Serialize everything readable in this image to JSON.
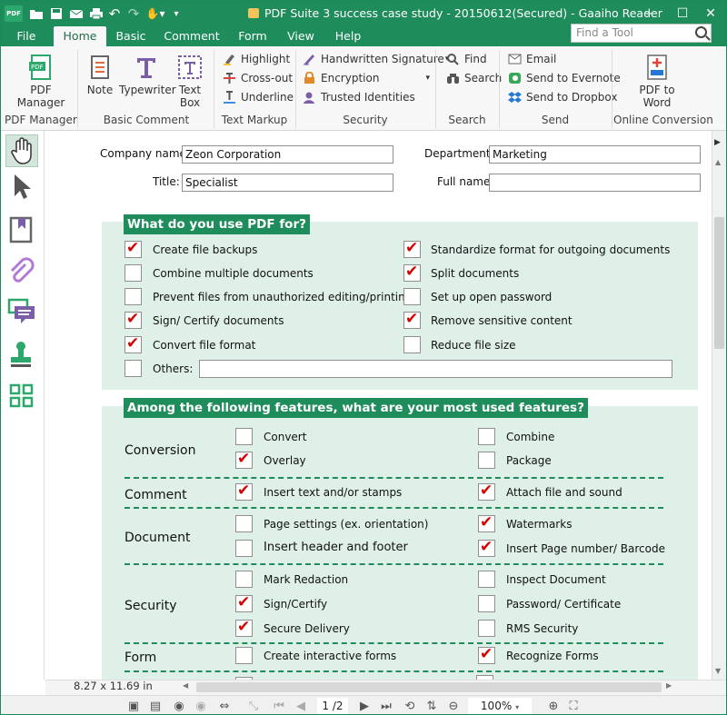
{
  "app": {
    "title": "PDF Suite  3 success case study - 20150612(Secured) - Gaaiho Reader",
    "logo_text": "PDF"
  },
  "quick_access": [
    "open-folder-icon",
    "save-icon",
    "email-icon",
    "print-icon",
    "undo-icon",
    "redo-icon",
    "hand-dropdown-icon",
    "customize-icon"
  ],
  "menu_tabs": [
    "File",
    "Home",
    "Basic",
    "Comment",
    "Form",
    "View",
    "Help"
  ],
  "find_tool": {
    "placeholder": "Find a Tool"
  },
  "ribbon": {
    "pdf_manager": {
      "button": "PDF\nManager",
      "line1": "PDF",
      "line2": "Manager",
      "group": "PDF Manager"
    },
    "basic_comment": {
      "note": "Note",
      "typewriter": "Typewriter",
      "textbox_line1": "Text",
      "textbox_line2": "Box",
      "group": "Basic Comment"
    },
    "text_markup": {
      "highlight": "Highlight",
      "crossout": "Cross-out",
      "underline": "Underline",
      "group": "Text Markup"
    },
    "security": {
      "handwritten": "Handwritten Signature",
      "encryption": "Encryption",
      "trusted": "Trusted Identities",
      "group": "Security"
    },
    "search": {
      "find": "Find",
      "search": "Search",
      "group": "Search"
    },
    "send": {
      "email": "Email",
      "evernote": "Send to Evernote",
      "dropbox": "Send to Dropbox",
      "group": "Send"
    },
    "online": {
      "line1": "PDF to",
      "line2": "Word",
      "group": "Online Conversion"
    }
  },
  "form": {
    "company_label": "Company name:",
    "company_value": "Zeon Corporation",
    "department_label": "Department:",
    "department_value": "Marketing",
    "title_label": "Title:",
    "title_value": "Specialist",
    "fullname_label": "Full name:",
    "fullname_value": ""
  },
  "section1": {
    "heading": "What do you use PDF for?",
    "left": [
      {
        "label": "Create file backups",
        "checked": true
      },
      {
        "label": "Combine multiple documents",
        "checked": false
      },
      {
        "label": "Prevent files from unauthorized editing/printing",
        "checked": false
      },
      {
        "label": "Sign/ Certify documents",
        "checked": true
      },
      {
        "label": "Convert file format",
        "checked": true
      }
    ],
    "right": [
      {
        "label": "Standardize format for outgoing documents",
        "checked": true
      },
      {
        "label": "Split documents",
        "checked": true
      },
      {
        "label": "Set up open password",
        "checked": false
      },
      {
        "label": "Remove sensitive content",
        "checked": true
      },
      {
        "label": "Reduce file size",
        "checked": false
      }
    ],
    "others_label": "Others:",
    "others_checked": false,
    "others_value": ""
  },
  "section2": {
    "heading": "Among the following features,   what are your most used features?",
    "categories": {
      "conversion": "Conversion",
      "comment": "Comment",
      "document": "Document",
      "security": "Security",
      "form": "Form"
    },
    "items": {
      "convert": {
        "label": "Convert",
        "checked": false
      },
      "combine": {
        "label": "Combine",
        "checked": false
      },
      "overlay": {
        "label": "Overlay",
        "checked": true
      },
      "package": {
        "label": "Package",
        "checked": false
      },
      "insert_text": {
        "label": "Insert text and/or stamps",
        "checked": true
      },
      "attach": {
        "label": "Attach file and sound",
        "checked": true
      },
      "page_settings": {
        "label": "Page settings (ex. orientation)",
        "checked": false
      },
      "watermarks": {
        "label": "Watermarks",
        "checked": true
      },
      "header_footer": {
        "label": "Insert header and footer",
        "checked": false
      },
      "page_number": {
        "label": "Insert Page number/ Barcode",
        "checked": true
      },
      "mark_redaction": {
        "label": "Mark Redaction",
        "checked": false
      },
      "inspect": {
        "label": "Inspect Document",
        "checked": false
      },
      "sign_certify": {
        "label": "Sign/Certify",
        "checked": true
      },
      "password": {
        "label": "Password/ Certificate",
        "checked": false
      },
      "secure_delivery": {
        "label": "Secure Delivery",
        "checked": true
      },
      "rms": {
        "label": "RMS Security",
        "checked": false
      },
      "interactive_forms": {
        "label": "Create interactive forms",
        "checked": false
      },
      "recognize_forms": {
        "label": "Recognize Forms",
        "checked": true
      }
    }
  },
  "status": {
    "page_size": "8.27 x 11.69 in",
    "page_indicator": "1 /2",
    "zoom": "100%"
  },
  "colors": {
    "brand_green": "#1f8c5b",
    "section_bg": "#dff0e8",
    "check_red": "#d40000"
  }
}
